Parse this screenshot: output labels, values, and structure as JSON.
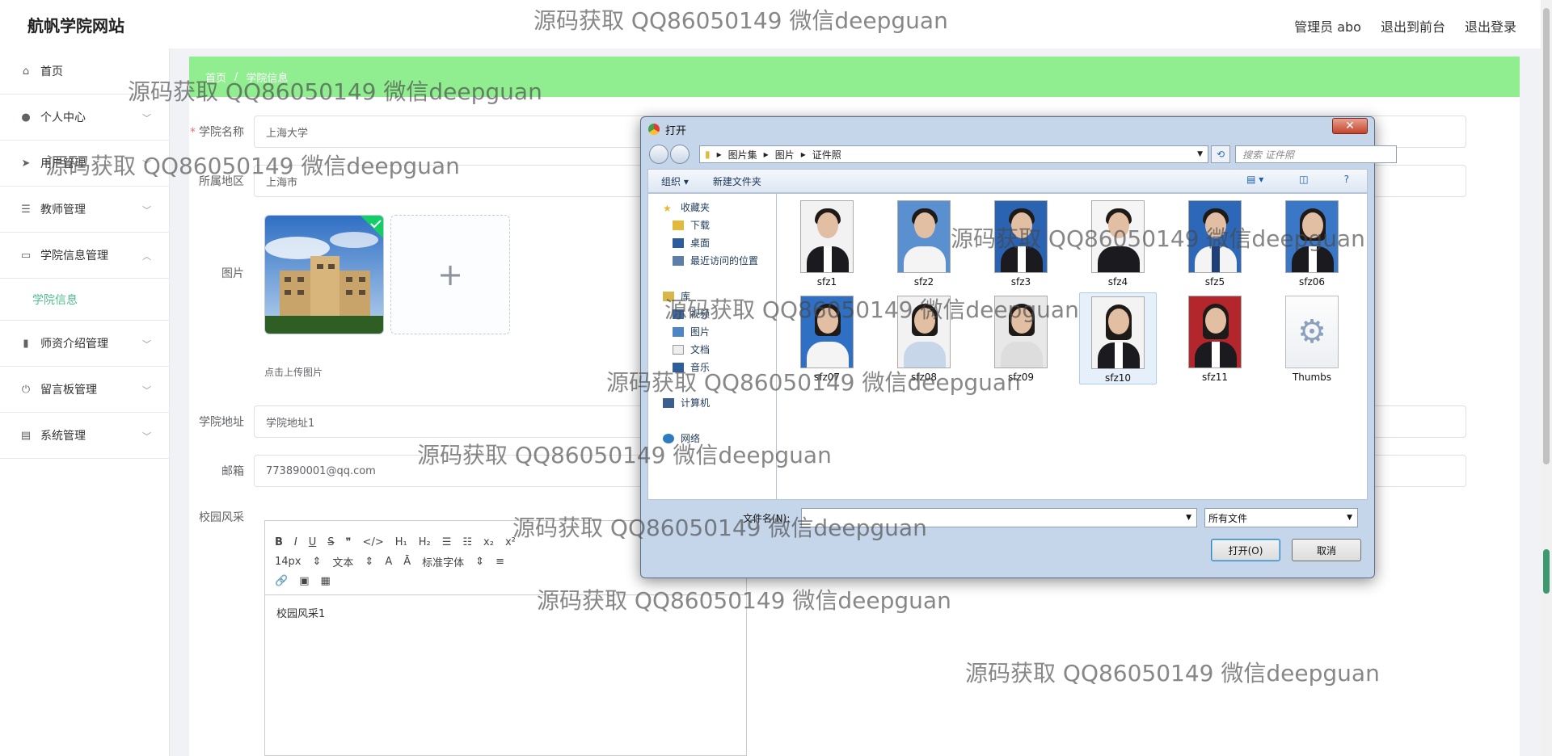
{
  "header": {
    "logo": "航帆学院网站",
    "links": [
      "管理员 abo",
      "退出到前台",
      "退出登录"
    ]
  },
  "sidebar": {
    "items": [
      {
        "label": "首页",
        "icon": "home-icon"
      },
      {
        "label": "个人中心",
        "icon": "user-icon"
      },
      {
        "label": "用户管理",
        "icon": "send-icon"
      },
      {
        "label": "教师管理",
        "icon": "sliders-icon"
      },
      {
        "label": "学院信息管理",
        "icon": "chat-icon",
        "expanded": true
      },
      {
        "label": "师资介绍管理",
        "icon": "bar-chart-icon"
      },
      {
        "label": "留言板管理",
        "icon": "power-icon"
      },
      {
        "label": "系统管理",
        "icon": "card-icon"
      }
    ],
    "sub_item": "学院信息"
  },
  "breadcrumb": [
    "首页",
    "学院信息"
  ],
  "form": {
    "name_label": "学院名称",
    "name_value": "上海大学",
    "region_label": "所属地区",
    "region_value": "上海市",
    "image_label": "图片",
    "upload_tip": "点击上传图片",
    "address_label": "学院地址",
    "address_value": "学院地址1",
    "email_label": "邮箱",
    "email_value": "773890001@qq.com",
    "campus_label": "校园风采",
    "editor": {
      "font_size": "14px",
      "paragraph": "文本",
      "font_family": "标准字体",
      "content": "校园风采1"
    }
  },
  "dialog": {
    "title": "打开",
    "path": [
      "图片集",
      "图片",
      "证件照"
    ],
    "search_placeholder": "搜索 证件照",
    "toolbar": {
      "organize": "组织 ▾",
      "new_folder": "新建文件夹"
    },
    "nav": {
      "favorites": "收藏夹",
      "items": [
        "下载",
        "桌面",
        "最近访问的位置"
      ],
      "library": "库",
      "library_items": [
        "视频",
        "图片",
        "文档",
        "音乐"
      ],
      "computer": "计算机",
      "network": "网络"
    },
    "files": [
      "sfz1",
      "sfz2",
      "sfz3",
      "sfz4",
      "sfz5",
      "sfz06",
      "sfz07",
      "sfz08",
      "sfz09",
      "sfz10",
      "sfz11",
      "Thumbs"
    ],
    "filename_label": "文件名(N):",
    "filetype": "所有文件",
    "open_btn": "打开(O)",
    "cancel_btn": "取消"
  },
  "watermark": "源码获取 QQ86050149 微信deepguan"
}
